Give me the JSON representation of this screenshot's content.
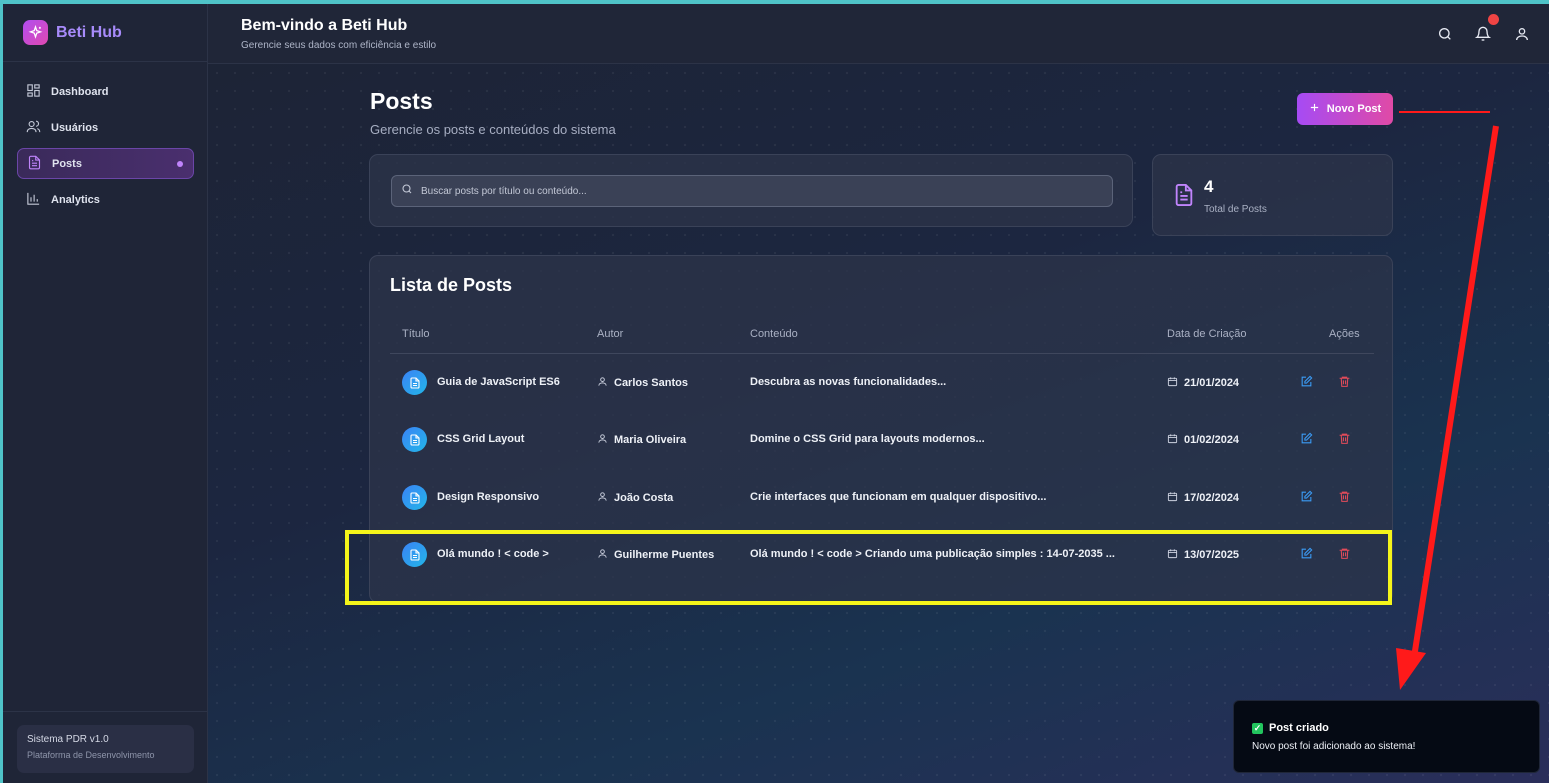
{
  "brand": {
    "name": "Beti Hub"
  },
  "header": {
    "title": "Bem-vindo a Beti Hub",
    "subtitle": "Gerencie seus dados com eficiência e estilo"
  },
  "sidebar": {
    "items": [
      {
        "label": "Dashboard",
        "icon": "grid-icon"
      },
      {
        "label": "Usuários",
        "icon": "users-icon"
      },
      {
        "label": "Posts",
        "icon": "document-icon",
        "active": true
      },
      {
        "label": "Analytics",
        "icon": "bar-chart-icon"
      }
    ],
    "footer": {
      "version": "Sistema PDR v1.0",
      "description": "Plataforma de Desenvolvimento"
    }
  },
  "page": {
    "title": "Posts",
    "subtitle": "Gerencie os posts e conteúdos do sistema",
    "new_button": "Novo Post"
  },
  "search": {
    "placeholder": "Buscar posts por título ou conteúdo..."
  },
  "stats": {
    "total": "4",
    "label": "Total de Posts"
  },
  "list": {
    "title": "Lista de Posts",
    "columns": [
      "Título",
      "Autor",
      "Conteúdo",
      "Data de Criação",
      "Ações"
    ],
    "rows": [
      {
        "title": "Guia de JavaScript ES6",
        "author": "Carlos Santos",
        "content": "Descubra as novas funcionalidades...",
        "date": "21/01/2024"
      },
      {
        "title": "CSS Grid Layout",
        "author": "Maria Oliveira",
        "content": "Domine o CSS Grid para layouts modernos...",
        "date": "01/02/2024"
      },
      {
        "title": "Design Responsivo",
        "author": "João Costa",
        "content": "Crie interfaces que funcionam em qualquer dispositivo...",
        "date": "17/02/2024"
      },
      {
        "title": "Olá mundo ! < code >",
        "author": "Guilherme Puentes",
        "content": "Olá mundo ! < code > Criando uma publicação simples : 14-07-2035 ...",
        "date": "13/07/2025"
      }
    ]
  },
  "toast": {
    "title": "Post criado",
    "message": "Novo post foi adicionado ao sistema!"
  },
  "colors": {
    "accent": "#a64bf4",
    "brand_pink": "#e04aa6",
    "highlight": "#f5f51a",
    "annotation": "#ff1a1a",
    "success": "#22c55e"
  }
}
